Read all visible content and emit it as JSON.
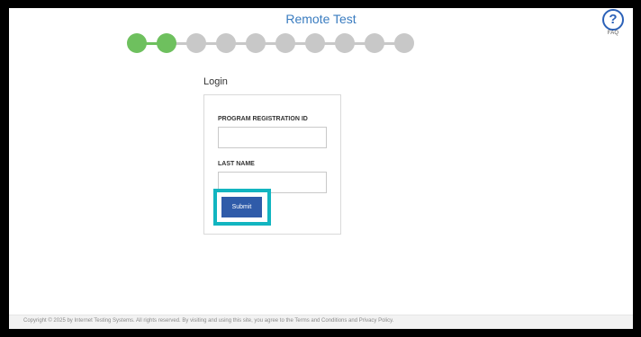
{
  "header": {
    "title": "Remote Test",
    "faq_label": "FAQ",
    "faq_glyph": "?"
  },
  "progress": {
    "total_steps": 10,
    "completed_steps": 2,
    "done_color": "#6ec05e",
    "pending_color": "#c8c8c8"
  },
  "login": {
    "heading": "Login",
    "program_id_label": "PROGRAM REGISTRATION ID",
    "program_id_value": "",
    "last_name_label": "LAST NAME",
    "last_name_value": "",
    "submit_label": "Submit"
  },
  "footer": {
    "copyright": "Copyright © 2025 by Internet Testing Systems. All rights reserved. By visiting and using this site, you agree to the Terms and Conditions and Privacy Policy."
  },
  "colors": {
    "accent": "#2f5ba9",
    "title": "#3a7cc0",
    "focus_ring": "#12b5c0"
  }
}
